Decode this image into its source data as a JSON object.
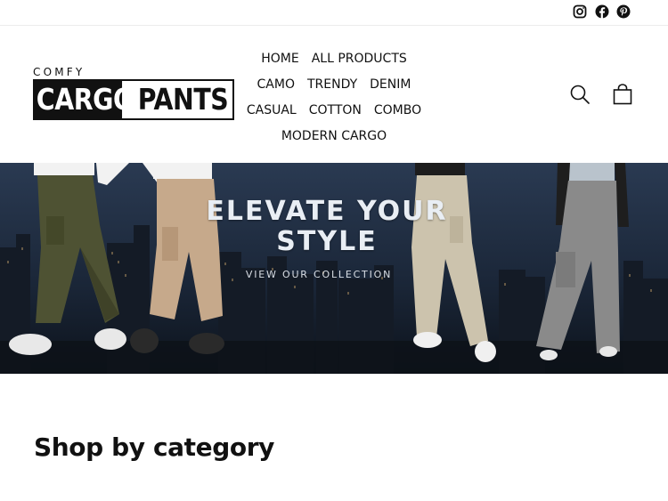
{
  "social": {
    "icons": [
      "instagram-icon",
      "facebook-icon",
      "pinterest-icon"
    ]
  },
  "logo": {
    "top": "COMFY",
    "left": "CARGO",
    "right": "PANTS"
  },
  "nav": {
    "rows": [
      [
        "HOME",
        "ALL PRODUCTS"
      ],
      [
        "CAMO",
        "TRENDY",
        "DENIM"
      ],
      [
        "CASUAL",
        "COTTON",
        "COMBO"
      ],
      [
        "MODERN CARGO"
      ]
    ]
  },
  "header_icons": {
    "search": "search-icon",
    "cart": "cart-icon"
  },
  "hero": {
    "title_line1": "ELEVATE YOUR",
    "title_line2": "STYLE",
    "link": "VIEW OUR COLLECTION"
  },
  "categories": {
    "title": "Shop by category"
  },
  "colors": {
    "text": "#111111",
    "hero_sky": "#1c2a3e",
    "background": "#ffffff"
  }
}
